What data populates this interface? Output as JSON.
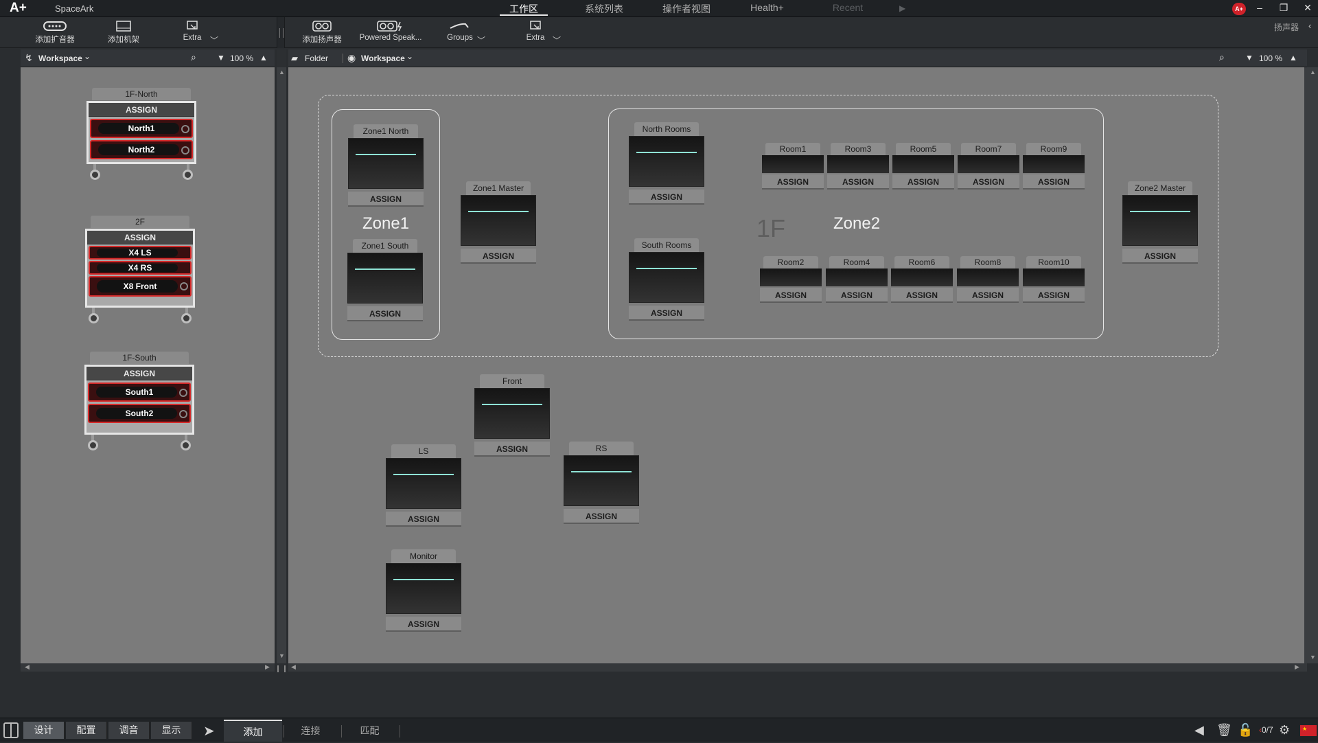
{
  "titlebar": {
    "logo": "A+",
    "app_name": "SpaceArk",
    "nav_tabs": [
      "工作区",
      "系统列表",
      "操作者视图",
      "Health+",
      "Recent"
    ],
    "badge": "A+"
  },
  "toolbar": {
    "left_buttons": [
      "添加扩音器",
      "添加机架",
      "Extra"
    ],
    "main_buttons": [
      "添加扬声器",
      "Powered Speak...",
      "Groups",
      "Extra"
    ],
    "right_label": "扬声器"
  },
  "left_pane": {
    "workspace_label": "Workspace",
    "zoom": "100 %",
    "racks": [
      {
        "name": "1F-North",
        "assign": "ASSIGN",
        "amps": [
          "North1",
          "North2"
        ]
      },
      {
        "name": "2F",
        "assign": "ASSIGN",
        "amps": [
          "X4 LS",
          "X4 RS",
          "X8 Front"
        ]
      },
      {
        "name": "1F-South",
        "assign": "ASSIGN",
        "amps": [
          "South1",
          "South2"
        ]
      }
    ]
  },
  "main_pane": {
    "folder_label": "Folder",
    "workspace_label": "Workspace",
    "zoom": "100 %",
    "zone1": {
      "title": "Zone1",
      "speakers": [
        {
          "name": "Zone1 North",
          "assign": "ASSIGN"
        },
        {
          "name": "Zone1 South",
          "assign": "ASSIGN"
        }
      ]
    },
    "zone1_master": {
      "name": "Zone1 Master",
      "assign": "ASSIGN"
    },
    "zone2": {
      "title": "Zone2",
      "floor_label": "1F",
      "speakers": [
        {
          "name": "North Rooms",
          "assign": "ASSIGN"
        },
        {
          "name": "South Rooms",
          "assign": "ASSIGN"
        }
      ],
      "rooms_top": [
        {
          "name": "Room1",
          "assign": "ASSIGN"
        },
        {
          "name": "Room3",
          "assign": "ASSIGN"
        },
        {
          "name": "Room5",
          "assign": "ASSIGN"
        },
        {
          "name": "Room7",
          "assign": "ASSIGN"
        },
        {
          "name": "Room9",
          "assign": "ASSIGN"
        }
      ],
      "rooms_bottom": [
        {
          "name": "Room2",
          "assign": "ASSIGN"
        },
        {
          "name": "Room4",
          "assign": "ASSIGN"
        },
        {
          "name": "Room6",
          "assign": "ASSIGN"
        },
        {
          "name": "Room8",
          "assign": "ASSIGN"
        },
        {
          "name": "Room10",
          "assign": "ASSIGN"
        }
      ]
    },
    "zone2_master": {
      "name": "Zone2 Master",
      "assign": "ASSIGN"
    },
    "free_speakers": [
      {
        "name": "Front",
        "assign": "ASSIGN"
      },
      {
        "name": "LS",
        "assign": "ASSIGN"
      },
      {
        "name": "RS",
        "assign": "ASSIGN"
      },
      {
        "name": "Monitor",
        "assign": "ASSIGN"
      }
    ]
  },
  "bottombar": {
    "modes": [
      "设计",
      "配置",
      "调音",
      "显示"
    ],
    "subtabs": [
      "添加",
      "连接",
      "匹配"
    ],
    "counter": "0/7"
  },
  "colors": {
    "amp_red": "#d62a2a",
    "level_line": "#8fe3d6",
    "canvas": "#7b7b7b",
    "badge_red": "#d0222a"
  }
}
